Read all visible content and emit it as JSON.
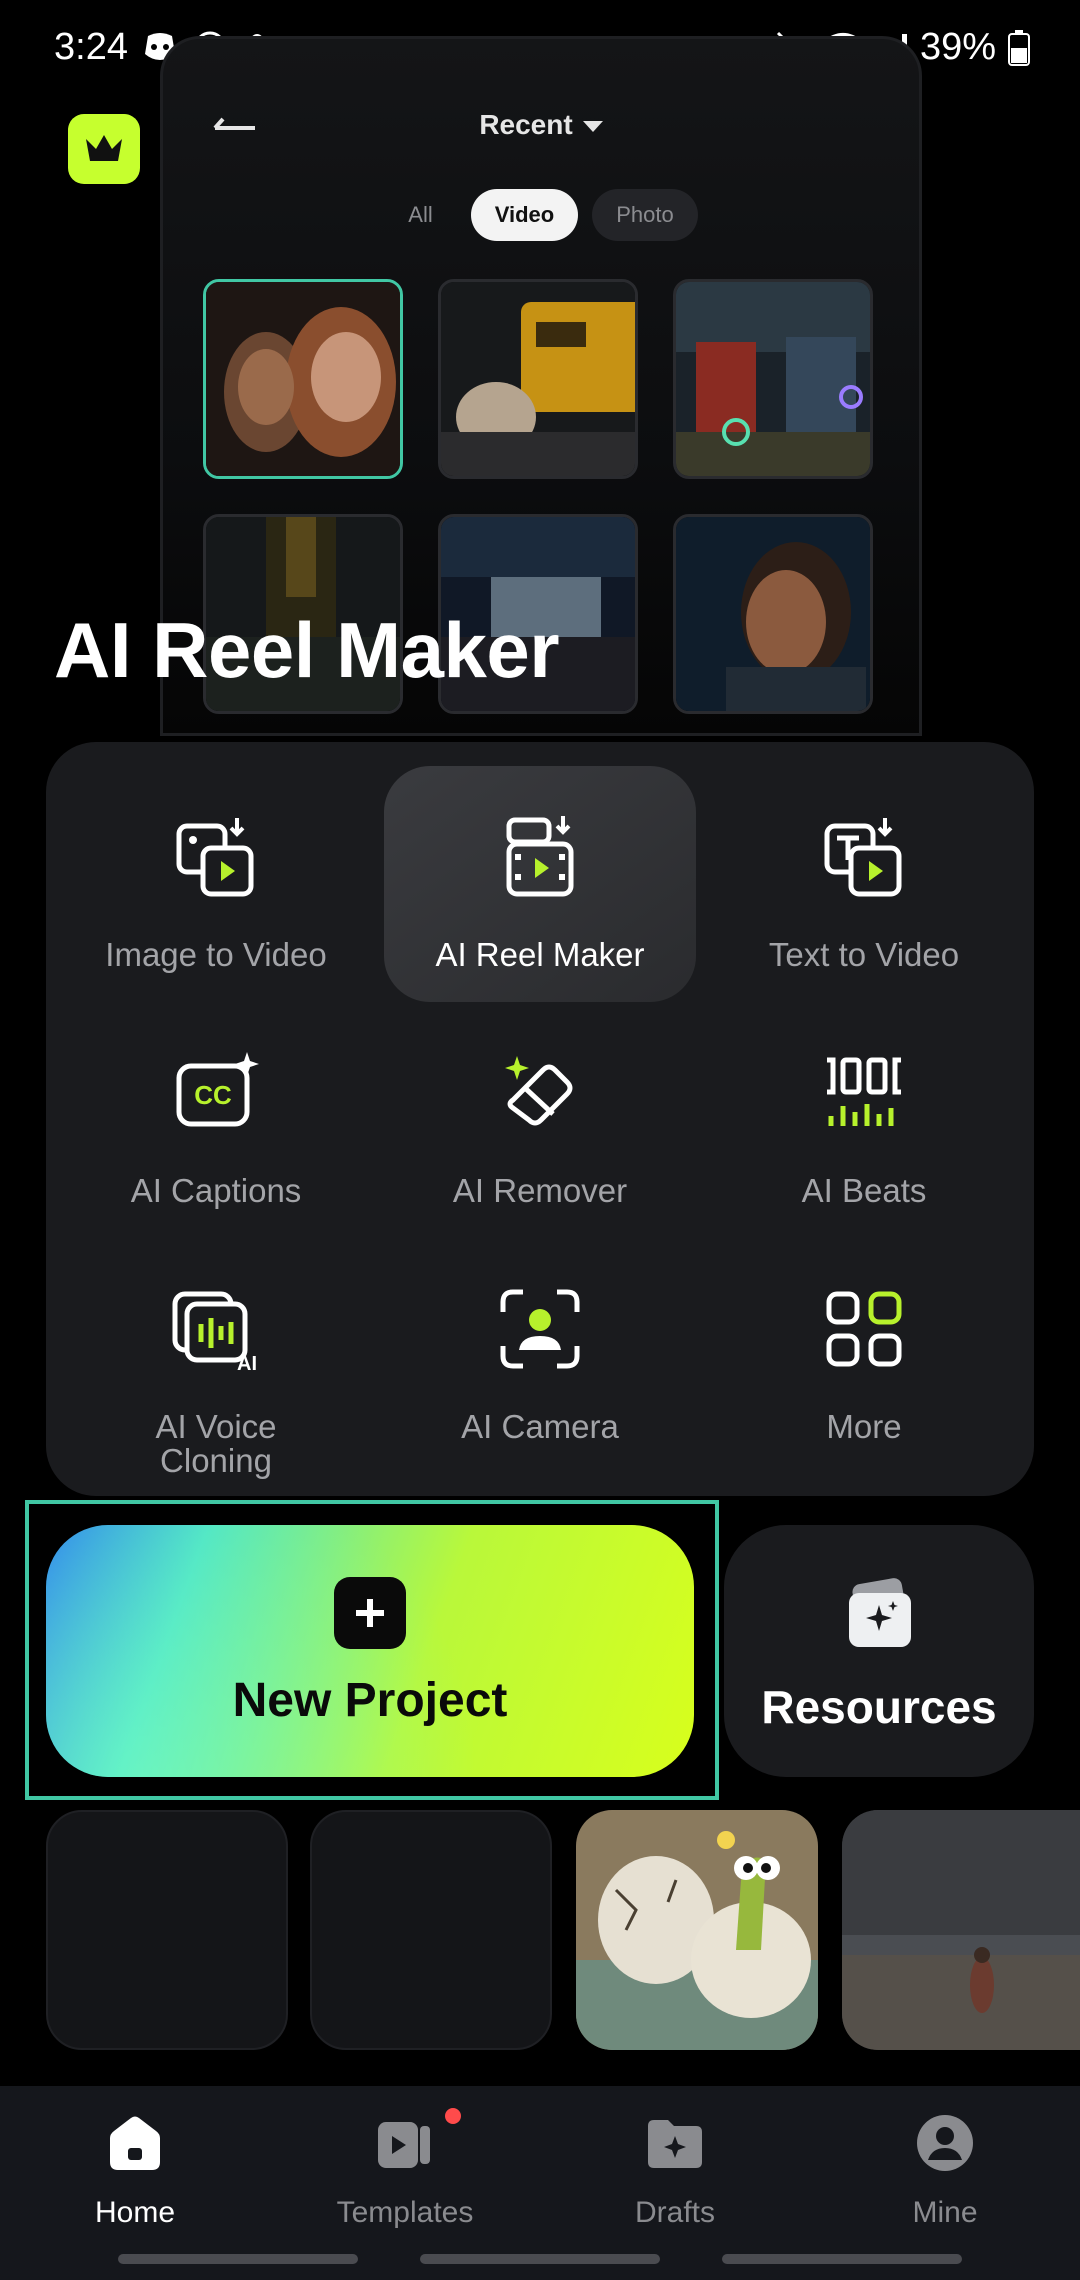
{
  "status_bar": {
    "time": "3:24",
    "battery": "39%",
    "left_icons": [
      "discord-icon",
      "whatsapp-icon",
      "stocks-app-icon"
    ],
    "right_icons": [
      "mute-icon",
      "wifi-icon",
      "signal-icon",
      "battery-icon"
    ]
  },
  "hero": {
    "dropdown_label": "Recent",
    "filters": [
      "All",
      "Video",
      "Photo"
    ],
    "active_filter": "Video",
    "title": "AI Reel Maker"
  },
  "tools": [
    {
      "label": "Image to Video",
      "icon": "image-to-video-icon"
    },
    {
      "label": "AI Reel Maker",
      "icon": "reel-maker-icon",
      "active": true
    },
    {
      "label": "Text to Video",
      "icon": "text-to-video-icon"
    },
    {
      "label": "AI Captions",
      "icon": "captions-icon"
    },
    {
      "label": "AI Remover",
      "icon": "eraser-icon"
    },
    {
      "label": "AI Beats",
      "icon": "beats-icon"
    },
    {
      "label": "AI Voice\nCloning",
      "icon": "voice-cloning-icon"
    },
    {
      "label": "AI Camera",
      "icon": "camera-icon"
    },
    {
      "label": "More",
      "icon": "grid-icon"
    }
  ],
  "actions": {
    "new_project": "New Project",
    "resources": "Resources"
  },
  "nav": {
    "items": [
      {
        "label": "Home",
        "icon": "home-icon",
        "active": true
      },
      {
        "label": "Templates",
        "icon": "templates-icon",
        "badge": true
      },
      {
        "label": "Drafts",
        "icon": "drafts-icon"
      },
      {
        "label": "Mine",
        "icon": "profile-icon"
      }
    ]
  },
  "colors": {
    "accent_green": "#c6ff2e",
    "teal": "#41c7a4",
    "panel": "#1a1b1e"
  }
}
